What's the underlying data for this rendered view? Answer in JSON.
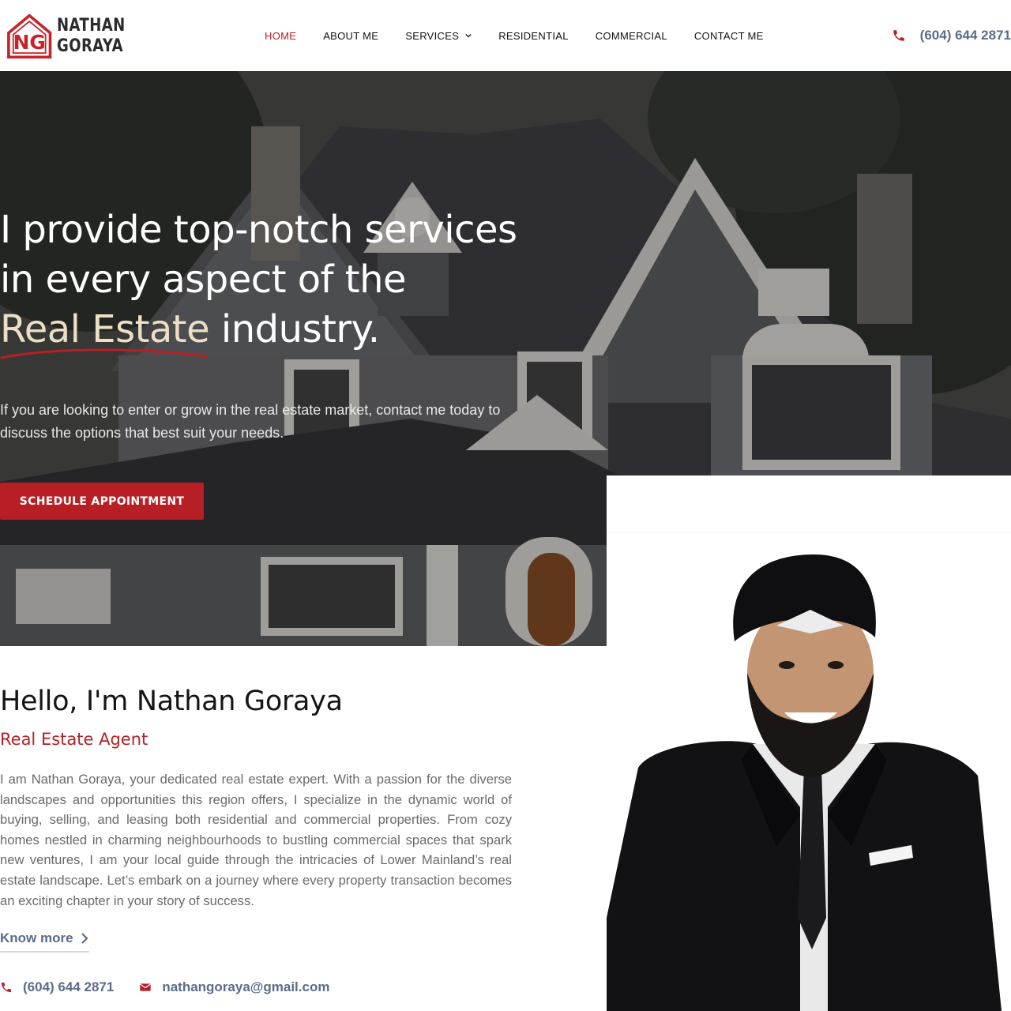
{
  "brand": {
    "logo_mark": "NG",
    "name_line1": "NATHAN",
    "name_line2": "GORAYA",
    "accent_color": "#b71f24",
    "link_color": "#5b6b8a"
  },
  "nav": {
    "items": [
      {
        "label": "HOME",
        "active": true
      },
      {
        "label": "ABOUT ME",
        "active": false
      },
      {
        "label": "SERVICES",
        "active": false,
        "has_dropdown": true
      },
      {
        "label": "RESIDENTIAL",
        "active": false
      },
      {
        "label": "COMMERCIAL",
        "active": false
      },
      {
        "label": "CONTACT ME",
        "active": false
      }
    ]
  },
  "header": {
    "phone": "(604) 644 2871",
    "phone_icon": "phone-icon"
  },
  "hero": {
    "title_line1": "I provide top-notch services",
    "title_line2": "in every aspect of the",
    "title_highlight": "Real Estate",
    "title_end": " industry.",
    "subtitle": "If you are looking to enter or grow in the real estate market, contact me today to discuss the options that best suit your needs.",
    "cta_label": "SCHEDULE APPOINTMENT"
  },
  "about": {
    "title": "Hello, I'm Nathan Goraya",
    "role": "Real Estate Agent",
    "body": "I am Nathan Goraya, your dedicated real estate expert. With a passion for the diverse landscapes and opportunities this region offers, I specialize in the dynamic world of buying, selling, and leasing both residential and commercial properties. From cozy homes nestled in charming neighbourhoods to bustling commercial spaces that spark new ventures, I am your local guide through the intricacies of Lower Mainland’s real estate landscape. Let’s embark on a journey where every property transaction becomes an exciting chapter in your story of success.",
    "know_more_label": "Know more",
    "know_more_icon": "chevron-right-icon"
  },
  "contact": {
    "phone": "(604) 644 2871",
    "phone_icon": "phone-icon",
    "email": "nathangoraya@gmail.com",
    "email_icon": "envelope-icon"
  }
}
